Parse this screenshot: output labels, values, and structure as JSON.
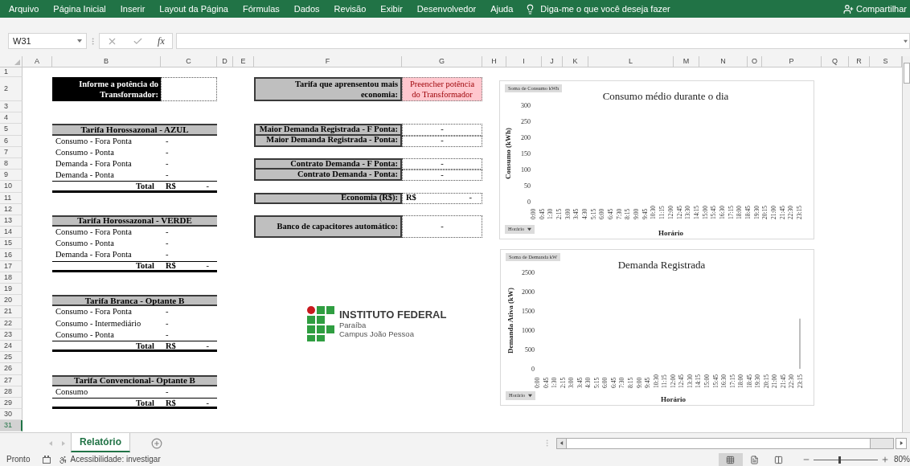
{
  "ribbon": {
    "tabs": [
      "Arquivo",
      "Página Inicial",
      "Inserir",
      "Layout da Página",
      "Fórmulas",
      "Dados",
      "Revisão",
      "Exibir",
      "Desenvolvedor",
      "Ajuda"
    ],
    "tell_me": "Diga-me o que você deseja fazer",
    "share": "Compartilhar"
  },
  "formula_bar": {
    "name_box": "W31",
    "function_label": "fx"
  },
  "columns": [
    "A",
    "B",
    "C",
    "D",
    "E",
    "F",
    "G",
    "H",
    "I",
    "J",
    "K",
    "L",
    "M",
    "N",
    "O",
    "P",
    "Q",
    "R",
    "S"
  ],
  "rows": [
    {
      "label": "1",
      "selected": false
    },
    {
      "label": "2",
      "selected": false
    },
    {
      "label": "3",
      "selected": false
    },
    {
      "label": "4",
      "selected": false
    },
    {
      "label": "5",
      "selected": false
    },
    {
      "label": "6",
      "selected": false
    },
    {
      "label": "7",
      "selected": false
    },
    {
      "label": "8",
      "selected": false
    },
    {
      "label": "9",
      "selected": false
    },
    {
      "label": "10",
      "selected": false
    },
    {
      "label": "11",
      "selected": false
    },
    {
      "label": "12",
      "selected": false
    },
    {
      "label": "13",
      "selected": false
    },
    {
      "label": "14",
      "selected": false
    },
    {
      "label": "15",
      "selected": false
    },
    {
      "label": "16",
      "selected": false
    },
    {
      "label": "17",
      "selected": false
    },
    {
      "label": "18",
      "selected": false
    },
    {
      "label": "19",
      "selected": false
    },
    {
      "label": "20",
      "selected": false
    },
    {
      "label": "21",
      "selected": false
    },
    {
      "label": "22",
      "selected": false
    },
    {
      "label": "23",
      "selected": false
    },
    {
      "label": "24",
      "selected": false
    },
    {
      "label": "25",
      "selected": false
    },
    {
      "label": "26",
      "selected": false
    },
    {
      "label": "27",
      "selected": false
    },
    {
      "label": "28",
      "selected": false
    },
    {
      "label": "29",
      "selected": false
    },
    {
      "label": "30",
      "selected": false
    },
    {
      "label": "31",
      "selected": true
    }
  ],
  "transformer": {
    "label": "Informe a potência do Transformador:"
  },
  "tariffs": [
    {
      "title": "Tarifa Horossazonal - AZUL",
      "items": [
        {
          "label": "Consumo - Fora Ponta",
          "value": "-"
        },
        {
          "label": "Consumo - Ponta",
          "value": "-"
        },
        {
          "label": "Demanda - Fora Ponta",
          "value": "-"
        },
        {
          "label": "Demanda - Ponta",
          "value": "-"
        }
      ],
      "total": {
        "label": "Total",
        "currency": "R$",
        "value": "-"
      }
    },
    {
      "title": "Tarifa Horossazonal - VERDE",
      "items": [
        {
          "label": "Consumo - Fora Ponta",
          "value": "-"
        },
        {
          "label": "Consumo - Ponta",
          "value": "-"
        },
        {
          "label": "Demanda - Fora Ponta",
          "value": "-"
        }
      ],
      "total": {
        "label": "Total",
        "currency": "R$",
        "value": "-"
      }
    },
    {
      "title": "Tarifa Branca - Optante B",
      "items": [
        {
          "label": "Consumo - Fora Ponta",
          "value": "-"
        },
        {
          "label": "Consumo - Intermediário",
          "value": "-"
        },
        {
          "label": "Consumo - Ponta",
          "value": "-"
        }
      ],
      "total": {
        "label": "Total",
        "currency": "R$",
        "value": "-"
      }
    },
    {
      "title": "Tarifa Convencional- Optante B",
      "items": [
        {
          "label": "Consumo",
          "value": "-"
        }
      ],
      "total": {
        "label": "Total",
        "currency": "R$",
        "value": "-"
      }
    }
  ],
  "summary": {
    "best": {
      "label": "Tarifa que aprensentou mais economia:",
      "value": "Preencher potência do Transformador",
      "alert": true
    },
    "groups": [
      {
        "kind": "stack",
        "rows": [
          {
            "label": "Maior Demanda Registrada - F Ponta:",
            "value": "-"
          },
          {
            "label": "Maior Demanda Registrada - Ponta:",
            "value": "-"
          }
        ]
      },
      {
        "kind": "stack",
        "rows": [
          {
            "label": "Contrato Demanda - F Ponta:",
            "value": "-"
          },
          {
            "label": "Contrato Demanda - Ponta:",
            "value": "-"
          }
        ]
      },
      {
        "kind": "stack",
        "rows": [
          {
            "label": "Economia (R$):",
            "currency": "R$",
            "value": "-"
          }
        ]
      },
      {
        "kind": "tall",
        "rows": [
          {
            "label": "Banco de capacitores automático:",
            "value": "-"
          }
        ]
      }
    ]
  },
  "logo": {
    "name": "INSTITUTO FEDERAL",
    "lines": [
      "Paraíba",
      "Campus João Pessoa"
    ]
  },
  "charts": [
    {
      "field_button": "Soma de Consumo kWh",
      "axis_button": "Horário",
      "chart_data": {
        "type": "bar",
        "title": "Consumo médio durante o dia",
        "xlabel": "Horário",
        "ylabel": "Consumo (kWh)",
        "categories": [
          "0:00",
          "0:45",
          "1:30",
          "2:15",
          "3:00",
          "3:45",
          "4:30",
          "5:15",
          "6:00",
          "6:45",
          "7:30",
          "8:15",
          "9:00",
          "9:45",
          "10:30",
          "11:15",
          "12:00",
          "12:45",
          "13:30",
          "14:15",
          "15:00",
          "15:45",
          "16:30",
          "17:15",
          "18:00",
          "18:45",
          "19:30",
          "20:15",
          "21:00",
          "21:45",
          "22:30",
          "23:15"
        ],
        "values": [
          null,
          null,
          null,
          null,
          null,
          null,
          null,
          null,
          null,
          null,
          null,
          null,
          null,
          null,
          null,
          null,
          null,
          null,
          null,
          null,
          null,
          null,
          null,
          null,
          null,
          null,
          null,
          null,
          null,
          null,
          null,
          null
        ],
        "ylim": [
          0,
          300
        ],
        "yticks": [
          0,
          50,
          100,
          150,
          200,
          250,
          300
        ]
      }
    },
    {
      "field_button": "Soma de Demanda kW",
      "axis_button": "Horário",
      "chart_data": {
        "type": "bar",
        "title": "Demanda Registrada",
        "xlabel": "Horário",
        "ylabel": "Demanda Ativa (kW)",
        "categories": [
          "0:00",
          "0:45",
          "1:30",
          "2:15",
          "3:00",
          "3:45",
          "4:30",
          "5:15",
          "6:00",
          "6:45",
          "7:30",
          "8:15",
          "9:00",
          "9:45",
          "10:30",
          "11:15",
          "12:00",
          "12:45",
          "13:30",
          "14:15",
          "15:00",
          "15:45",
          "16:30",
          "17:15",
          "18:00",
          "18:45",
          "19:30",
          "20:15",
          "21:00",
          "21:45",
          "22:30",
          "23:15"
        ],
        "values": [
          null,
          null,
          null,
          null,
          null,
          null,
          null,
          null,
          null,
          null,
          null,
          null,
          null,
          null,
          null,
          null,
          null,
          null,
          null,
          null,
          null,
          null,
          null,
          null,
          null,
          null,
          null,
          null,
          null,
          null,
          null,
          1300
        ],
        "ylim": [
          0,
          2500
        ],
        "yticks": [
          0,
          500,
          1000,
          1500,
          2000,
          2500
        ]
      }
    }
  ],
  "sheet_tabs": [
    {
      "label": "Relatório",
      "selected": true
    }
  ],
  "status_bar": {
    "ready": "Pronto",
    "accessibility": "Acessibilidade: investigar",
    "views": [
      {
        "kind": "normal",
        "selected": true
      },
      {
        "kind": "page_layout",
        "selected": false
      },
      {
        "kind": "page_break",
        "selected": false
      }
    ],
    "zoom": {
      "level": 0.4,
      "reading": "80%"
    }
  }
}
